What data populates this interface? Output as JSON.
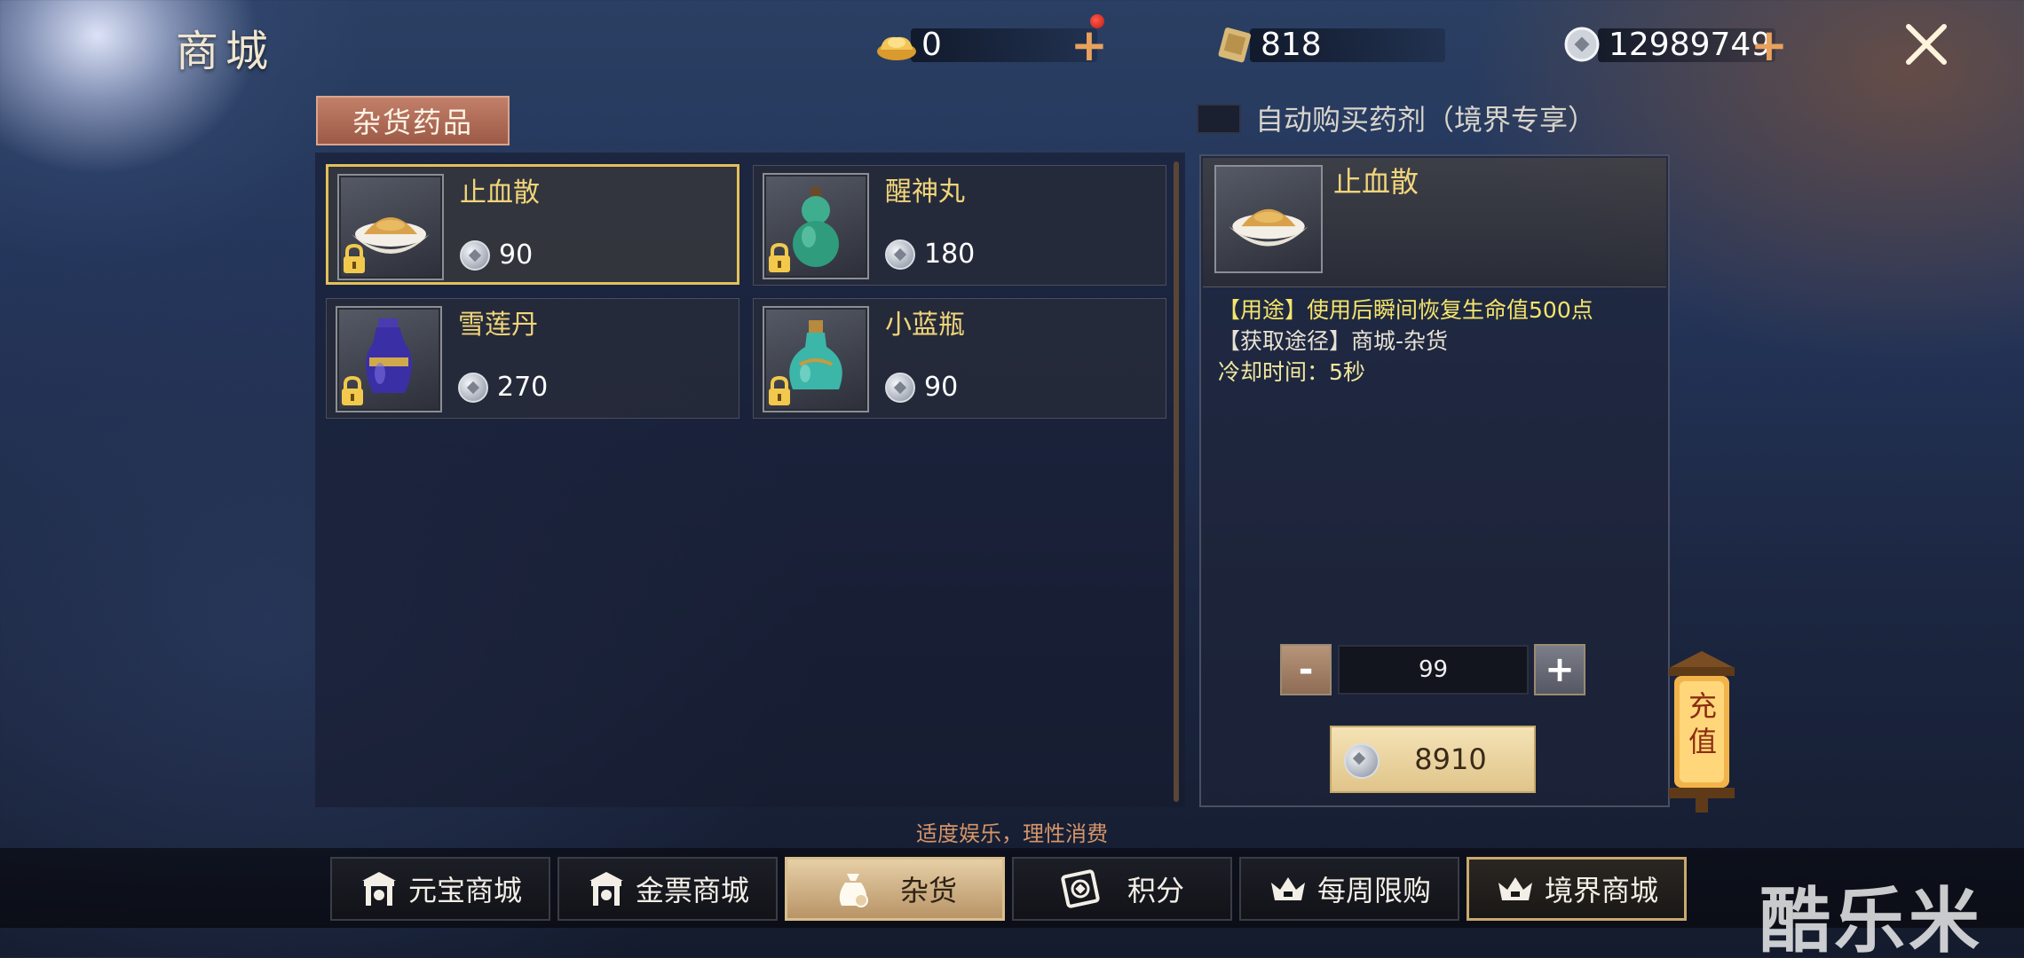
{
  "header": {
    "title": "商城",
    "currencies": [
      {
        "name": "gold-ingot",
        "value": "0"
      },
      {
        "name": "gold-ticket",
        "value": "818"
      },
      {
        "name": "silver-coin",
        "value": "12989749"
      }
    ]
  },
  "category_tab": "杂货药品",
  "auto_buy": {
    "label": "自动购买药剂（境界专享）",
    "checked": false
  },
  "items": [
    {
      "name": "止血散",
      "price": "90",
      "selected": true,
      "locked": true,
      "icon": "powder-icon"
    },
    {
      "name": "醒神丸",
      "price": "180",
      "selected": false,
      "locked": true,
      "icon": "gourd-icon"
    },
    {
      "name": "雪莲丹",
      "price": "270",
      "selected": false,
      "locked": true,
      "icon": "blue-vase-icon"
    },
    {
      "name": "小蓝瓶",
      "price": "90",
      "selected": false,
      "locked": true,
      "icon": "teal-bottle-icon"
    }
  ],
  "detail": {
    "name": "止血散",
    "usage": "【用途】使用后瞬间恢复生命值500点",
    "source": "【获取途径】商城-杂货",
    "cooldown": "冷却时间：5秒",
    "quantity": "99",
    "total": "8910",
    "minus": "-",
    "plus": "+"
  },
  "recharge": "充值",
  "notice": "适度娱乐，理性消费",
  "nav": [
    {
      "label": "元宝商城",
      "icon": "shop-icon"
    },
    {
      "label": "金票商城",
      "icon": "shop-icon"
    },
    {
      "label": "杂货",
      "icon": "bag-icon",
      "active": true
    },
    {
      "label": "积分",
      "icon": "points-icon"
    },
    {
      "label": "每周限购",
      "icon": "crown-icon"
    },
    {
      "label": "境界商城",
      "icon": "crown-icon"
    }
  ],
  "watermark": "酷乐米",
  "colors": {
    "item_name": "#f1d57a",
    "usage_text": "#f5e56a",
    "selected_border": "#e2c15a",
    "notice": "#d5956a"
  }
}
